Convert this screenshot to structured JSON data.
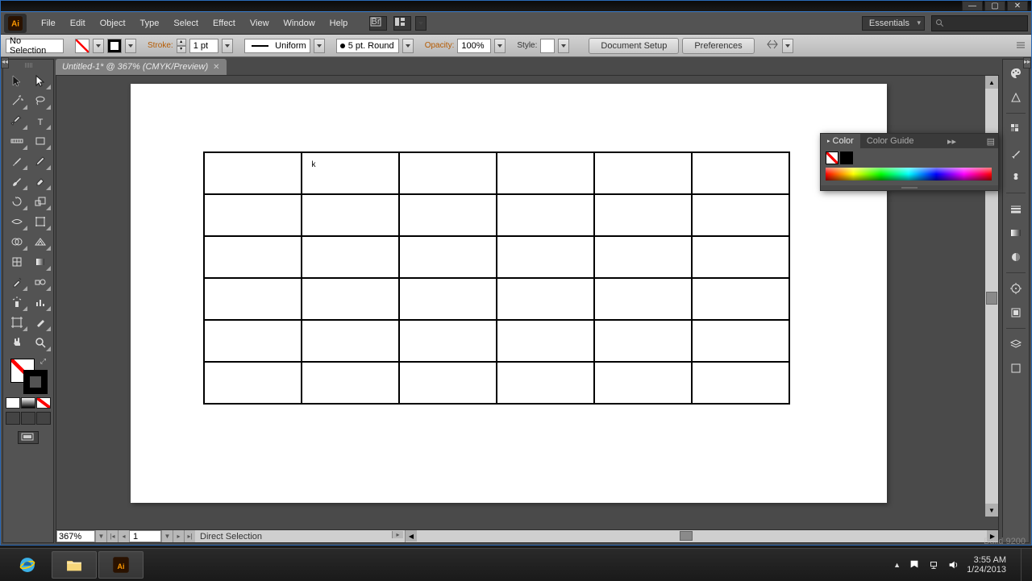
{
  "window": {
    "minimize": "—",
    "maximize": "▢",
    "close": "✕"
  },
  "menu": [
    "File",
    "Edit",
    "Object",
    "Type",
    "Select",
    "Effect",
    "View",
    "Window",
    "Help"
  ],
  "workspace": "Essentials",
  "control": {
    "selection": "No Selection",
    "stroke_label": "Stroke:",
    "stroke_weight": "1 pt",
    "profile": "Uniform",
    "brush": "5 pt. Round",
    "opacity_label": "Opacity:",
    "opacity": "100%",
    "style_label": "Style:",
    "doc_setup": "Document Setup",
    "prefs": "Preferences"
  },
  "doc": {
    "tab": "Untitled-1* @ 367% (CMYK/Preview)"
  },
  "table_grid": {
    "rows": 6,
    "cols": 6
  },
  "status": {
    "zoom": "367%",
    "page": "1",
    "tool_hint": "Direct Selection"
  },
  "panels": {
    "color": "Color",
    "color_guide": "Color Guide"
  },
  "build": "Build 9200",
  "tray": {
    "time": "3:55 AM",
    "date": "1/24/2013"
  }
}
